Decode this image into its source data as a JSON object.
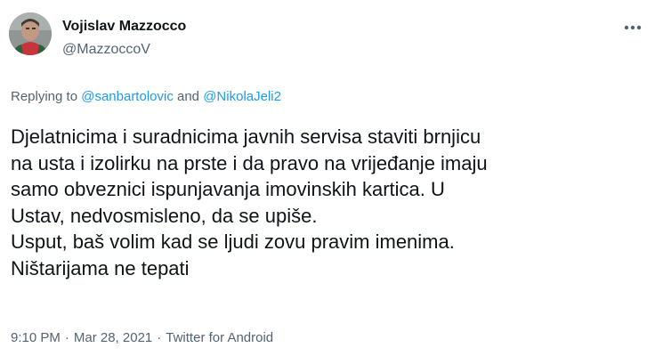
{
  "author": {
    "display_name": "Vojislav Mazzocco",
    "handle": "@MazzoccoV"
  },
  "reply": {
    "prefix": "Replying to ",
    "mention_1": "@sanbartolovic",
    "joiner": " and ",
    "mention_2": "@NikolaJeli2"
  },
  "tweet": {
    "text": "Djelatnicima i suradnicima javnih servisa staviti brnjicu\nna usta i izolirku na prste i da pravo na vrijeđanje imaju\nsamo obveznici ispunjavanja imovinskih kartica. U\nUstav, nedvosmisleno, da se upiše.\nUsput, baš volim kad se ljudi zovu pravim imenima.\nNištarijama ne tepati"
  },
  "meta": {
    "time": "9:10 PM",
    "separator": "·",
    "date": "Mar 28, 2021",
    "source": "Twitter for Android"
  },
  "icons": {
    "more": "more-options-icon",
    "avatar": "profile-photo"
  }
}
